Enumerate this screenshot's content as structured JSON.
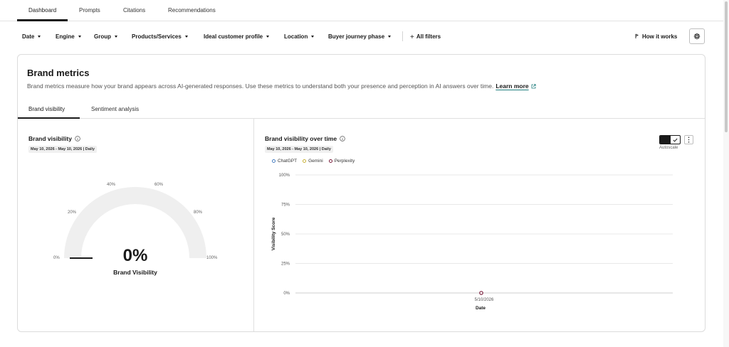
{
  "top_tabs": [
    {
      "label": "Dashboard",
      "active": true
    },
    {
      "label": "Prompts",
      "active": false
    },
    {
      "label": "Citations",
      "active": false
    },
    {
      "label": "Recommendations",
      "active": false
    }
  ],
  "filters": [
    {
      "label": "Date"
    },
    {
      "label": "Engine"
    },
    {
      "label": "Group"
    },
    {
      "label": "Products/Services"
    },
    {
      "label": "Ideal customer profile"
    },
    {
      "label": "Location"
    },
    {
      "label": "Buyer journey phase"
    }
  ],
  "all_filters_label": "All filters",
  "how_it_works_label": "How it works",
  "card": {
    "title": "Brand metrics",
    "description": "Brand metrics measure how your brand appears across AI-generated responses. Use these metrics to understand both your presence and perception in AI answers over time.",
    "learn_more": "Learn more",
    "sub_tabs": [
      {
        "label": "Brand visibility",
        "active": true
      },
      {
        "label": "Sentiment analysis",
        "active": false
      }
    ]
  },
  "gauge_panel": {
    "title": "Brand visibility",
    "date_range": "May 10, 2026 - May 10, 2026 | Daily",
    "tick_labels": [
      "0%",
      "20%",
      "40%",
      "60%",
      "80%",
      "100%"
    ],
    "value": "0%",
    "value_fraction": 0,
    "caption": "Brand Visibility"
  },
  "chart_panel": {
    "title": "Brand visibility over time",
    "date_range": "May 10, 2026 - May 10, 2026 | Daily",
    "autoscale_label": "Autoscale",
    "autoscale_on": true
  },
  "chart_data": {
    "type": "line",
    "xlabel": "Date",
    "ylabel": "Visibility Score",
    "x": [
      "5/10/2026"
    ],
    "ylim": [
      0,
      100
    ],
    "yticks": [
      "0%",
      "25%",
      "50%",
      "75%",
      "100%"
    ],
    "grid": true,
    "legend_position": "top-left",
    "series": [
      {
        "name": "ChatGPT",
        "color": "#4a7fc1",
        "values": [
          null
        ]
      },
      {
        "name": "Gemini",
        "color": "#c9b33a",
        "values": [
          null
        ]
      },
      {
        "name": "Perplexity",
        "color": "#7a1f3d",
        "values": [
          0
        ]
      }
    ]
  },
  "colors": {
    "accent": "#1c7c7c",
    "gauge_track": "#efefef",
    "text": "#1a1a1a"
  }
}
